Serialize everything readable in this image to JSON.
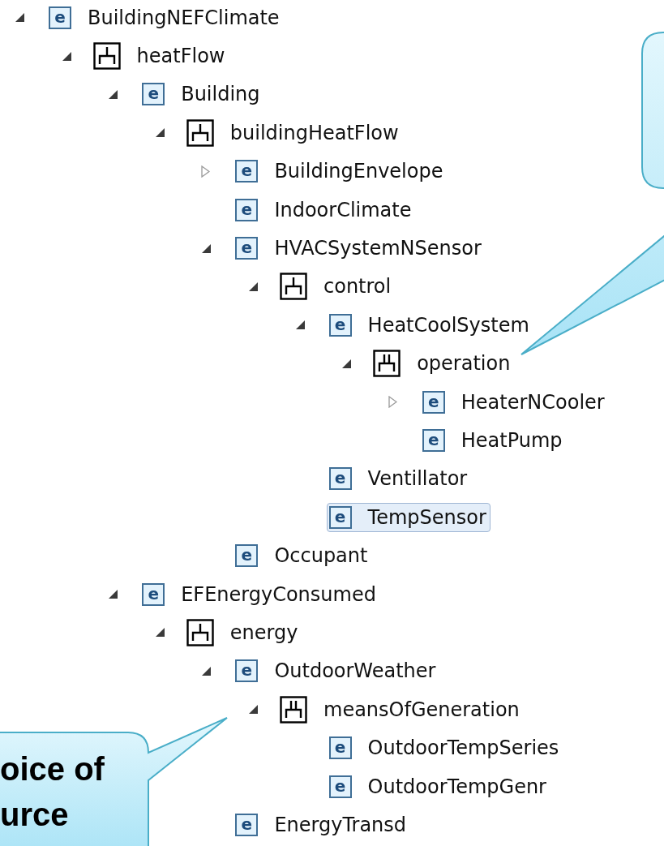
{
  "tree": [
    {
      "kind": "element",
      "badge": "e",
      "label": "BuildingNEFClimate",
      "expanded": true,
      "selected": false,
      "children": [
        {
          "kind": "sequence",
          "label": "heatFlow",
          "expanded": true,
          "selected": false,
          "children": [
            {
              "kind": "element",
              "badge": "e",
              "label": "Building",
              "expanded": true,
              "selected": false,
              "children": [
                {
                  "kind": "sequence",
                  "label": "buildingHeatFlow",
                  "expanded": true,
                  "selected": false,
                  "children": [
                    {
                      "kind": "element",
                      "badge": "e",
                      "label": "BuildingEnvelope",
                      "expanded": false,
                      "selected": false
                    },
                    {
                      "kind": "element",
                      "badge": "e",
                      "label": "IndoorClimate",
                      "selected": false
                    },
                    {
                      "kind": "element",
                      "badge": "e",
                      "label": "HVACSystemNSensor",
                      "expanded": true,
                      "selected": false,
                      "children": [
                        {
                          "kind": "sequence",
                          "label": "control",
                          "expanded": true,
                          "selected": false,
                          "children": [
                            {
                              "kind": "element",
                              "badge": "e",
                              "label": "HeatCoolSystem",
                              "expanded": true,
                              "selected": false,
                              "children": [
                                {
                                  "kind": "choice",
                                  "label": "operation",
                                  "expanded": true,
                                  "selected": false,
                                  "children": [
                                    {
                                      "kind": "element",
                                      "badge": "e",
                                      "label": "HeaterNCooler",
                                      "expanded": false,
                                      "selected": false
                                    },
                                    {
                                      "kind": "element",
                                      "badge": "e",
                                      "label": "HeatPump",
                                      "selected": false
                                    }
                                  ]
                                }
                              ]
                            },
                            {
                              "kind": "element",
                              "badge": "e",
                              "label": "Ventillator",
                              "selected": false
                            },
                            {
                              "kind": "element",
                              "badge": "e",
                              "label": "TempSensor",
                              "selected": true
                            }
                          ]
                        }
                      ]
                    },
                    {
                      "kind": "element",
                      "badge": "e",
                      "label": "Occupant",
                      "selected": false
                    }
                  ]
                }
              ]
            },
            {
              "kind": "element",
              "badge": "e",
              "label": "EFEnergyConsumed",
              "expanded": true,
              "selected": false,
              "children": [
                {
                  "kind": "sequence",
                  "label": "energy",
                  "expanded": true,
                  "selected": false,
                  "children": [
                    {
                      "kind": "element",
                      "badge": "e",
                      "label": "OutdoorWeather",
                      "expanded": true,
                      "selected": false,
                      "children": [
                        {
                          "kind": "choice",
                          "label": "meansOfGeneration",
                          "expanded": true,
                          "selected": false,
                          "children": [
                            {
                              "kind": "element",
                              "badge": "e",
                              "label": "OutdoorTempSeries",
                              "selected": false
                            },
                            {
                              "kind": "element",
                              "badge": "e",
                              "label": "OutdoorTempGenr",
                              "selected": false
                            }
                          ]
                        }
                      ]
                    },
                    {
                      "kind": "element",
                      "badge": "e",
                      "label": "EnergyTransd",
                      "selected": false
                    }
                  ]
                }
              ]
            }
          ]
        }
      ]
    }
  ],
  "callouts": [
    {
      "text_lines": [
        "oice of",
        "urce"
      ]
    }
  ]
}
